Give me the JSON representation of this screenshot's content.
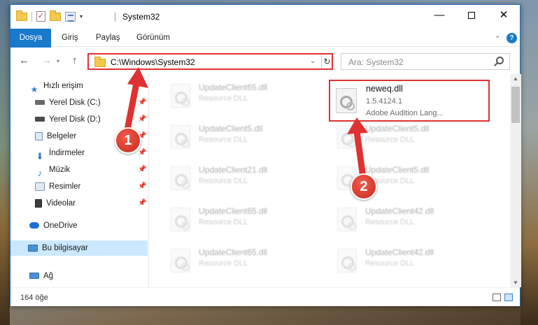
{
  "window": {
    "title": "System32",
    "controls": {
      "minimize": "—",
      "maximize": "",
      "close": "✕"
    }
  },
  "ribbon": {
    "tabs": [
      {
        "label": "Dosya"
      },
      {
        "label": "Giriş"
      },
      {
        "label": "Paylaş"
      },
      {
        "label": "Görünüm"
      }
    ],
    "help": "?"
  },
  "address_bar": {
    "path": "C:\\Windows\\System32",
    "refresh": "↻"
  },
  "search": {
    "placeholder": "Ara: System32"
  },
  "sidebar": {
    "items": [
      {
        "label": "Hızlı erişim",
        "icon": "star-icon"
      },
      {
        "label": "Yerel Disk (C:)",
        "icon": "drive-icon"
      },
      {
        "label": "Yerel Disk (D:)",
        "icon": "drive-icon"
      },
      {
        "label": "Belgeler",
        "icon": "documents-icon"
      },
      {
        "label": "İndirmeler",
        "icon": "download-icon"
      },
      {
        "label": "Müzik",
        "icon": "music-icon"
      },
      {
        "label": "Resimler",
        "icon": "pictures-icon"
      },
      {
        "label": "Videolar",
        "icon": "videos-icon"
      },
      {
        "label": "OneDrive",
        "icon": "cloud-icon"
      },
      {
        "label": "Bu bilgisayar",
        "icon": "computer-icon"
      },
      {
        "label": "Ağ",
        "icon": "network-icon"
      }
    ]
  },
  "files": {
    "highlighted": {
      "name": "neweq.dll",
      "version": "1.5.4124.1",
      "description": "Adobe Audition Lang..."
    },
    "others": [
      {
        "name": "UpdateClient65.dll",
        "type": "Resource DLL"
      },
      {
        "name": "UpdateClient5.dll",
        "type": "Resource DLL"
      },
      {
        "name": "UpdateClient5.dll",
        "type": "Resource DLL"
      },
      {
        "name": "UpdateClient21.dll",
        "type": "Resource DLL"
      },
      {
        "name": "UpdateClient5.dll",
        "type": "Resource DLL"
      },
      {
        "name": "UpdateClient65.dll",
        "type": "Resource DLL"
      },
      {
        "name": "UpdateClient42.dll",
        "type": "Resource DLL"
      },
      {
        "name": "UpdateClient65.dll",
        "type": "Resource DLL"
      },
      {
        "name": "UpdateClient42.dll",
        "type": "Resource DLL"
      }
    ]
  },
  "status": {
    "count": "164 öğe"
  },
  "annotations": {
    "step1": "1",
    "step2": "2",
    "color": "#e03131"
  }
}
